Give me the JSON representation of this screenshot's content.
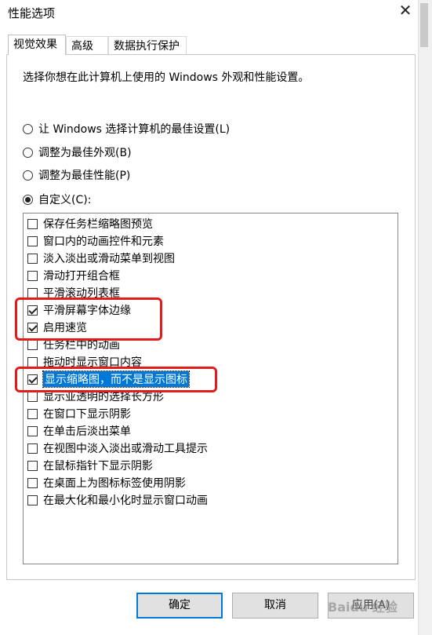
{
  "window": {
    "title": "性能选项"
  },
  "tabs": [
    {
      "label": "视觉效果"
    },
    {
      "label": "高级"
    },
    {
      "label": "数据执行保护"
    }
  ],
  "description": "选择你想在此计算机上使用的 Windows 外观和性能设置。",
  "radios": [
    {
      "label": "让 Windows 选择计算机的最佳设置(L)",
      "checked": false
    },
    {
      "label": "调整为最佳外观(B)",
      "checked": false
    },
    {
      "label": "调整为最佳性能(P)",
      "checked": false
    },
    {
      "label": "自定义(C):",
      "checked": true
    }
  ],
  "effects": [
    {
      "label": "保存任务栏缩略图预览",
      "checked": false
    },
    {
      "label": "窗口内的动画控件和元素",
      "checked": false
    },
    {
      "label": "淡入淡出或滑动菜单到视图",
      "checked": false
    },
    {
      "label": "滑动打开组合框",
      "checked": false
    },
    {
      "label": "平滑滚动列表框",
      "checked": false
    },
    {
      "label": "平滑屏幕字体边缘",
      "checked": true
    },
    {
      "label": "启用速览",
      "checked": true
    },
    {
      "label": "任务栏中的动画",
      "checked": false
    },
    {
      "label": "拖动时显示窗口内容",
      "checked": false
    },
    {
      "label": "显示缩略图，而不是显示图标",
      "checked": true,
      "selected": true
    },
    {
      "label": "显示亚透明的选择长方形",
      "checked": false
    },
    {
      "label": "在窗口下显示阴影",
      "checked": false
    },
    {
      "label": "在单击后淡出菜单",
      "checked": false
    },
    {
      "label": "在视图中淡入淡出或滑动工具提示",
      "checked": false
    },
    {
      "label": "在鼠标指针下显示阴影",
      "checked": false
    },
    {
      "label": "在桌面上为图标标签使用阴影",
      "checked": false
    },
    {
      "label": "在最大化和最小化时显示窗口动画",
      "checked": false
    }
  ],
  "buttons": {
    "ok": "确定",
    "cancel": "取消",
    "apply": "应用(A)"
  },
  "watermark": "Baidu 经验",
  "colors": {
    "highlight": "#e21b1b",
    "selection": "#0078d7"
  }
}
